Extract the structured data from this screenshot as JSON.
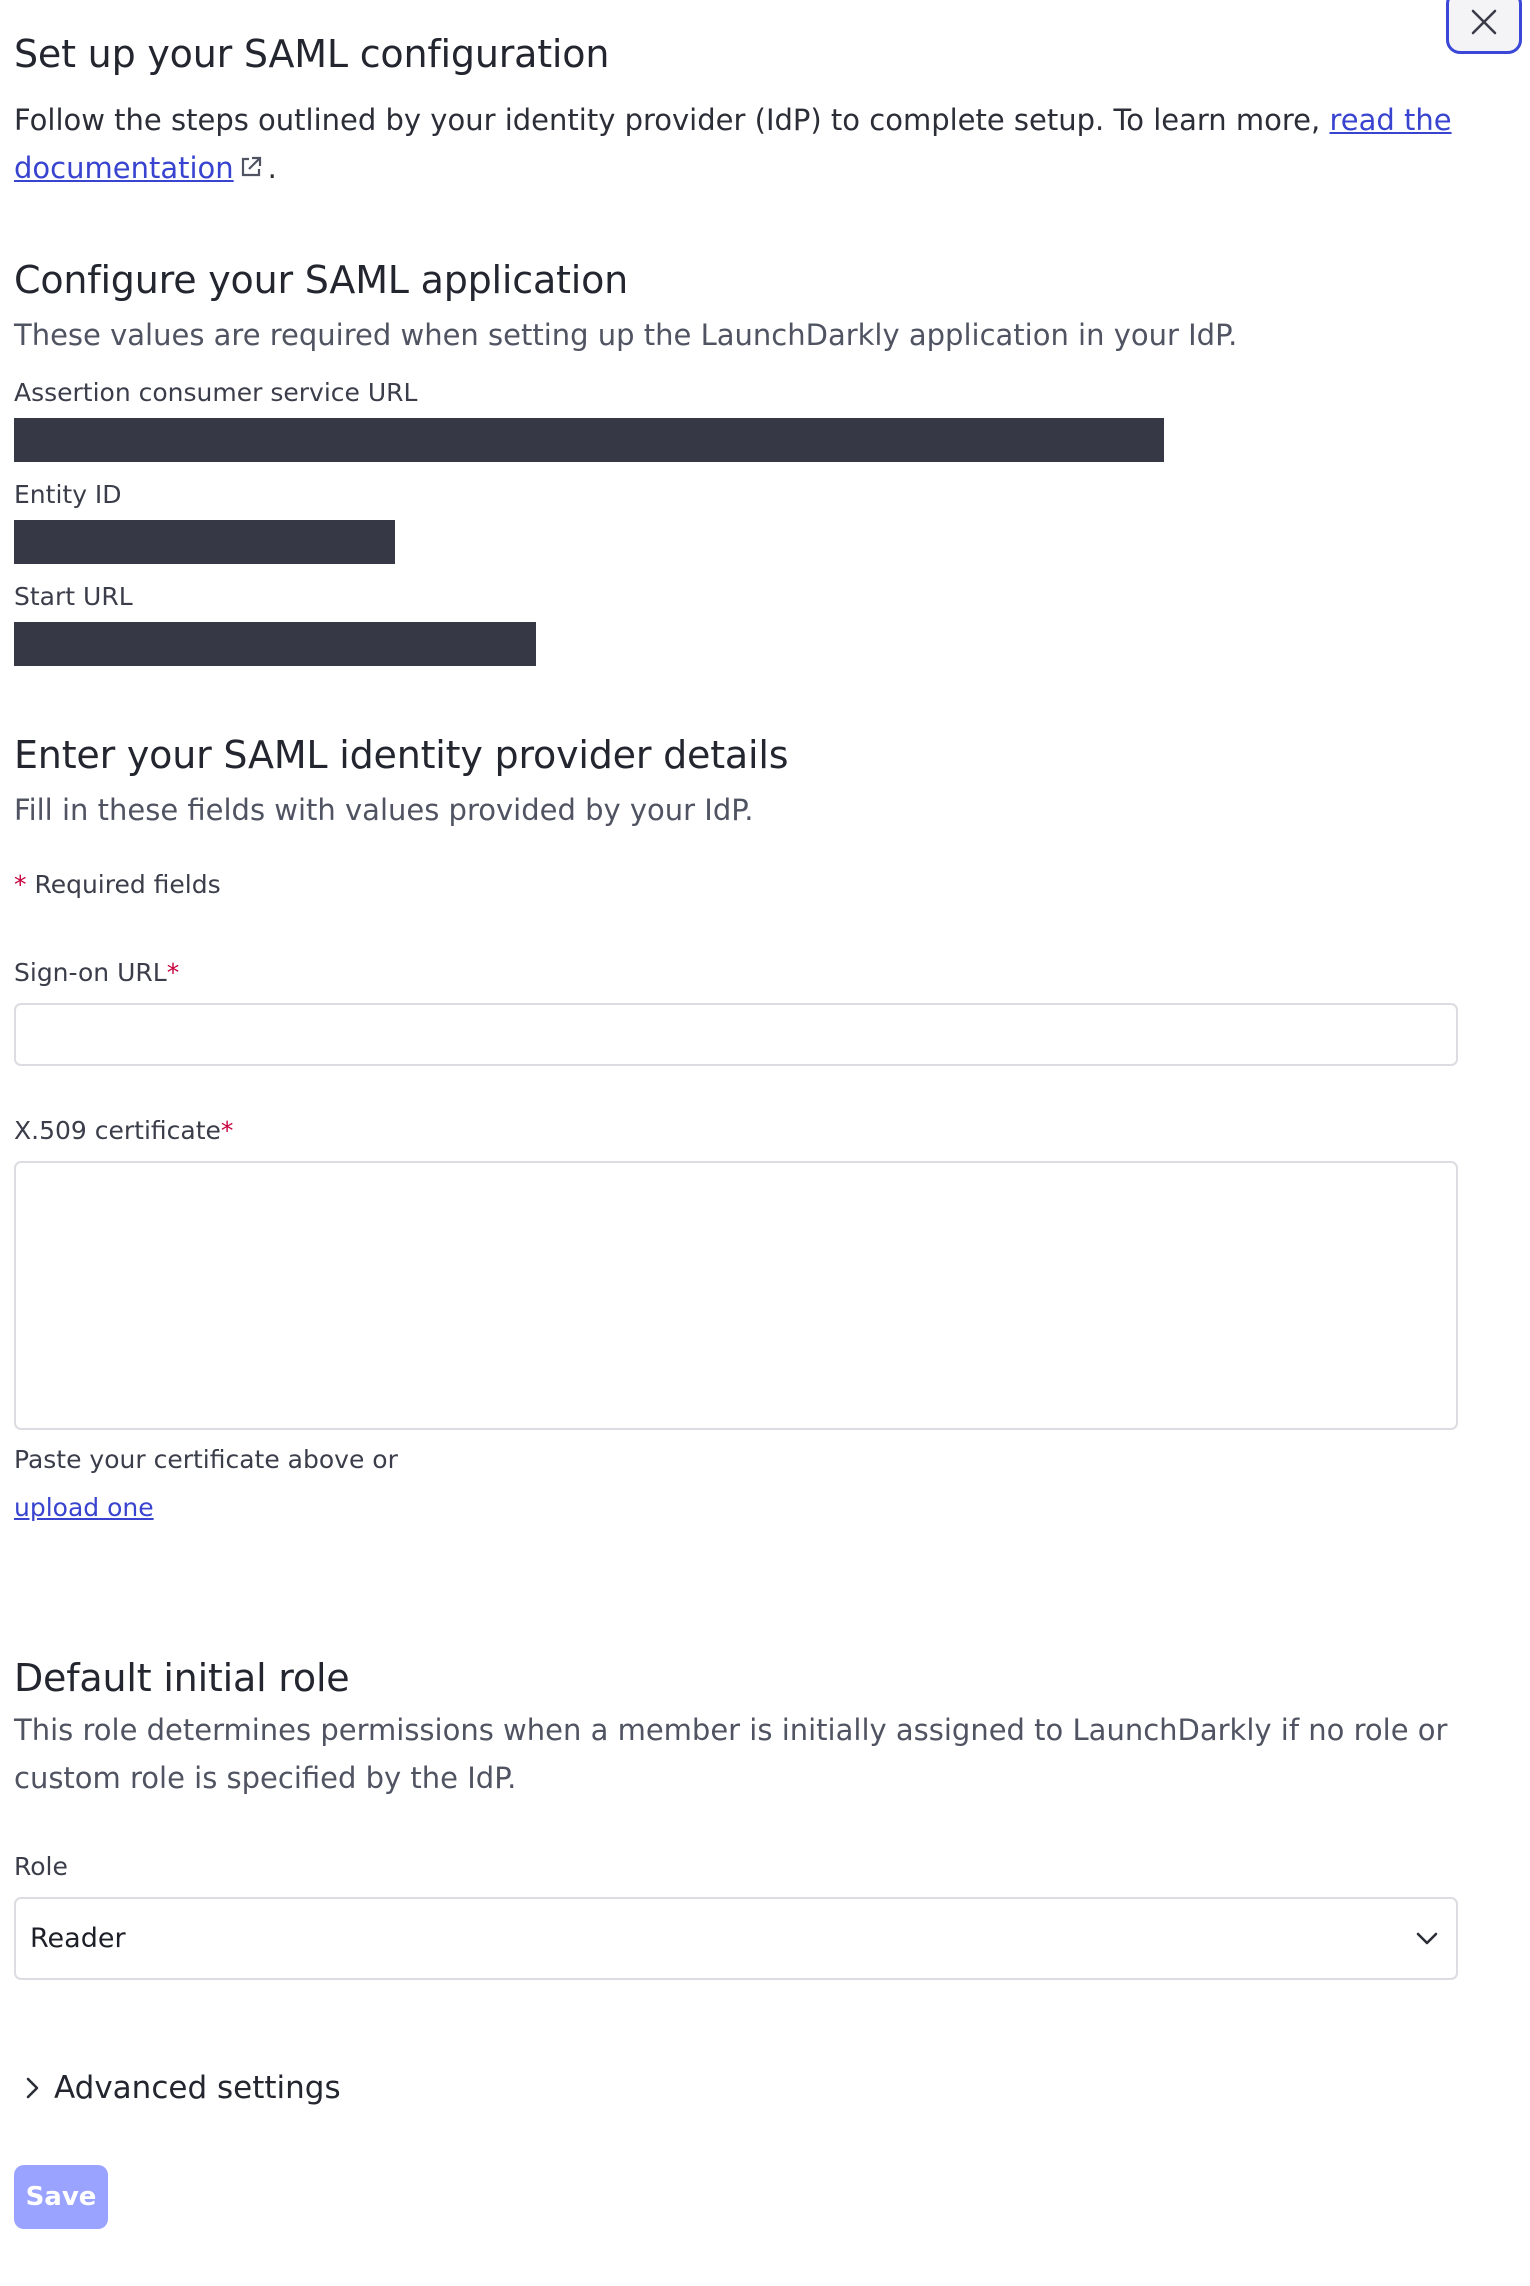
{
  "header": {
    "title": "Set up your SAML configuration",
    "intro_text": "Follow the steps outlined by your identity provider (IdP) to complete setup. To learn more,",
    "doc_link_part1": "read the",
    "doc_link_part2": "documentation",
    "period": "."
  },
  "configure": {
    "title": "Configure your SAML application",
    "subtitle": "These values are required when setting up the LaunchDarkly application in your IdP.",
    "fields": [
      {
        "label": "Assertion consumer service URL"
      },
      {
        "label": "Entity ID"
      },
      {
        "label": "Start URL"
      }
    ]
  },
  "idp": {
    "title": "Enter your SAML identity provider details",
    "subtitle": "Fill in these fields with values provided by your IdP.",
    "required_star": "*",
    "required_note": "Required fields",
    "sign_on_label": "Sign-on URL",
    "sign_on_value": "",
    "cert_label": "X.509 certificate",
    "cert_value": "",
    "cert_help": "Paste your certificate above or",
    "upload_link": "upload one"
  },
  "role_section": {
    "title": "Default initial role",
    "description_line1": "This role determines permissions when a member is initially assigned to LaunchDarkly if no role or",
    "description_line2": "custom role is specified by the IdP.",
    "role_label": "Role",
    "role_value": "Reader"
  },
  "advanced": {
    "label": "Advanced settings"
  },
  "actions": {
    "save_label": "Save"
  },
  "colors": {
    "link": "#3844cf",
    "required": "#c8003f",
    "save_button": "#9aa3ff",
    "close_border": "#3b47d6",
    "redaction": "#373845"
  }
}
